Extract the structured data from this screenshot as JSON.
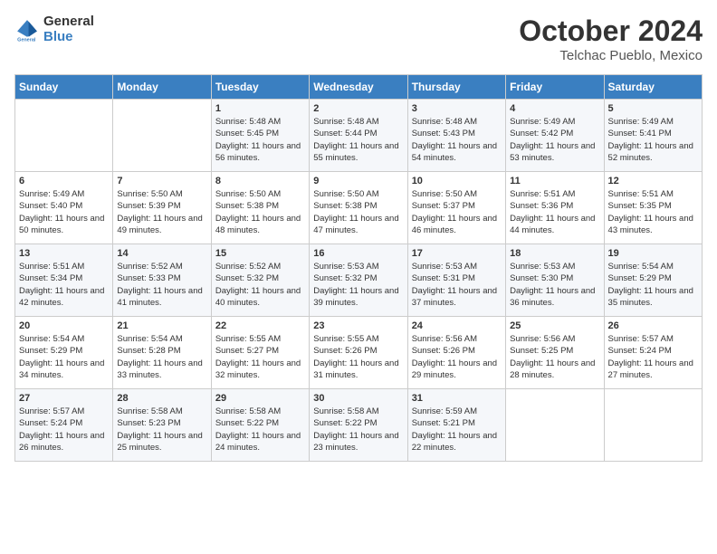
{
  "logo": {
    "line1": "General",
    "line2": "Blue"
  },
  "title": "October 2024",
  "location": "Telchac Pueblo, Mexico",
  "headers": [
    "Sunday",
    "Monday",
    "Tuesday",
    "Wednesday",
    "Thursday",
    "Friday",
    "Saturday"
  ],
  "weeks": [
    [
      {
        "day": "",
        "info": ""
      },
      {
        "day": "",
        "info": ""
      },
      {
        "day": "1",
        "sunrise": "Sunrise: 5:48 AM",
        "sunset": "Sunset: 5:45 PM",
        "daylight": "Daylight: 11 hours and 56 minutes."
      },
      {
        "day": "2",
        "sunrise": "Sunrise: 5:48 AM",
        "sunset": "Sunset: 5:44 PM",
        "daylight": "Daylight: 11 hours and 55 minutes."
      },
      {
        "day": "3",
        "sunrise": "Sunrise: 5:48 AM",
        "sunset": "Sunset: 5:43 PM",
        "daylight": "Daylight: 11 hours and 54 minutes."
      },
      {
        "day": "4",
        "sunrise": "Sunrise: 5:49 AM",
        "sunset": "Sunset: 5:42 PM",
        "daylight": "Daylight: 11 hours and 53 minutes."
      },
      {
        "day": "5",
        "sunrise": "Sunrise: 5:49 AM",
        "sunset": "Sunset: 5:41 PM",
        "daylight": "Daylight: 11 hours and 52 minutes."
      }
    ],
    [
      {
        "day": "6",
        "sunrise": "Sunrise: 5:49 AM",
        "sunset": "Sunset: 5:40 PM",
        "daylight": "Daylight: 11 hours and 50 minutes."
      },
      {
        "day": "7",
        "sunrise": "Sunrise: 5:50 AM",
        "sunset": "Sunset: 5:39 PM",
        "daylight": "Daylight: 11 hours and 49 minutes."
      },
      {
        "day": "8",
        "sunrise": "Sunrise: 5:50 AM",
        "sunset": "Sunset: 5:38 PM",
        "daylight": "Daylight: 11 hours and 48 minutes."
      },
      {
        "day": "9",
        "sunrise": "Sunrise: 5:50 AM",
        "sunset": "Sunset: 5:38 PM",
        "daylight": "Daylight: 11 hours and 47 minutes."
      },
      {
        "day": "10",
        "sunrise": "Sunrise: 5:50 AM",
        "sunset": "Sunset: 5:37 PM",
        "daylight": "Daylight: 11 hours and 46 minutes."
      },
      {
        "day": "11",
        "sunrise": "Sunrise: 5:51 AM",
        "sunset": "Sunset: 5:36 PM",
        "daylight": "Daylight: 11 hours and 44 minutes."
      },
      {
        "day": "12",
        "sunrise": "Sunrise: 5:51 AM",
        "sunset": "Sunset: 5:35 PM",
        "daylight": "Daylight: 11 hours and 43 minutes."
      }
    ],
    [
      {
        "day": "13",
        "sunrise": "Sunrise: 5:51 AM",
        "sunset": "Sunset: 5:34 PM",
        "daylight": "Daylight: 11 hours and 42 minutes."
      },
      {
        "day": "14",
        "sunrise": "Sunrise: 5:52 AM",
        "sunset": "Sunset: 5:33 PM",
        "daylight": "Daylight: 11 hours and 41 minutes."
      },
      {
        "day": "15",
        "sunrise": "Sunrise: 5:52 AM",
        "sunset": "Sunset: 5:32 PM",
        "daylight": "Daylight: 11 hours and 40 minutes."
      },
      {
        "day": "16",
        "sunrise": "Sunrise: 5:53 AM",
        "sunset": "Sunset: 5:32 PM",
        "daylight": "Daylight: 11 hours and 39 minutes."
      },
      {
        "day": "17",
        "sunrise": "Sunrise: 5:53 AM",
        "sunset": "Sunset: 5:31 PM",
        "daylight": "Daylight: 11 hours and 37 minutes."
      },
      {
        "day": "18",
        "sunrise": "Sunrise: 5:53 AM",
        "sunset": "Sunset: 5:30 PM",
        "daylight": "Daylight: 11 hours and 36 minutes."
      },
      {
        "day": "19",
        "sunrise": "Sunrise: 5:54 AM",
        "sunset": "Sunset: 5:29 PM",
        "daylight": "Daylight: 11 hours and 35 minutes."
      }
    ],
    [
      {
        "day": "20",
        "sunrise": "Sunrise: 5:54 AM",
        "sunset": "Sunset: 5:29 PM",
        "daylight": "Daylight: 11 hours and 34 minutes."
      },
      {
        "day": "21",
        "sunrise": "Sunrise: 5:54 AM",
        "sunset": "Sunset: 5:28 PM",
        "daylight": "Daylight: 11 hours and 33 minutes."
      },
      {
        "day": "22",
        "sunrise": "Sunrise: 5:55 AM",
        "sunset": "Sunset: 5:27 PM",
        "daylight": "Daylight: 11 hours and 32 minutes."
      },
      {
        "day": "23",
        "sunrise": "Sunrise: 5:55 AM",
        "sunset": "Sunset: 5:26 PM",
        "daylight": "Daylight: 11 hours and 31 minutes."
      },
      {
        "day": "24",
        "sunrise": "Sunrise: 5:56 AM",
        "sunset": "Sunset: 5:26 PM",
        "daylight": "Daylight: 11 hours and 29 minutes."
      },
      {
        "day": "25",
        "sunrise": "Sunrise: 5:56 AM",
        "sunset": "Sunset: 5:25 PM",
        "daylight": "Daylight: 11 hours and 28 minutes."
      },
      {
        "day": "26",
        "sunrise": "Sunrise: 5:57 AM",
        "sunset": "Sunset: 5:24 PM",
        "daylight": "Daylight: 11 hours and 27 minutes."
      }
    ],
    [
      {
        "day": "27",
        "sunrise": "Sunrise: 5:57 AM",
        "sunset": "Sunset: 5:24 PM",
        "daylight": "Daylight: 11 hours and 26 minutes."
      },
      {
        "day": "28",
        "sunrise": "Sunrise: 5:58 AM",
        "sunset": "Sunset: 5:23 PM",
        "daylight": "Daylight: 11 hours and 25 minutes."
      },
      {
        "day": "29",
        "sunrise": "Sunrise: 5:58 AM",
        "sunset": "Sunset: 5:22 PM",
        "daylight": "Daylight: 11 hours and 24 minutes."
      },
      {
        "day": "30",
        "sunrise": "Sunrise: 5:58 AM",
        "sunset": "Sunset: 5:22 PM",
        "daylight": "Daylight: 11 hours and 23 minutes."
      },
      {
        "day": "31",
        "sunrise": "Sunrise: 5:59 AM",
        "sunset": "Sunset: 5:21 PM",
        "daylight": "Daylight: 11 hours and 22 minutes."
      },
      {
        "day": "",
        "info": ""
      },
      {
        "day": "",
        "info": ""
      }
    ]
  ]
}
